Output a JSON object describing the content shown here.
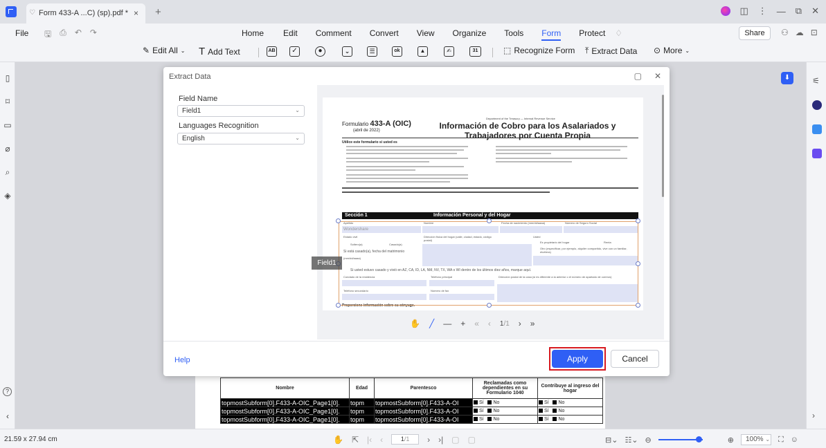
{
  "titlebar": {
    "tab_title": "Form 433-A ...C) (sp).pdf *",
    "tab_close": "×",
    "tab_add": "+",
    "controls": [
      "⋮",
      "—",
      "⧉",
      "✕"
    ]
  },
  "menubar": {
    "file": "File",
    "items": [
      "Home",
      "Edit",
      "Comment",
      "Convert",
      "View",
      "Organize",
      "Tools",
      "Form",
      "Protect"
    ],
    "active": "Form",
    "share": "Share"
  },
  "toolbar": {
    "edit_all": "Edit All",
    "add_text": "Add Text",
    "recognize_form": "Recognize Form",
    "extract_data": "Extract Data",
    "more": "More"
  },
  "dialog": {
    "title": "Extract Data",
    "field_name_label": "Field Name",
    "field_name_value": "Field1",
    "lang_label": "Languages Recognition",
    "lang_value": "English",
    "field_tag": "Field1",
    "help": "Help",
    "apply": "Apply",
    "cancel": "Cancel",
    "preview_page": "1",
    "preview_total": "/1"
  },
  "document": {
    "form_label": "Formulario",
    "form_number": "433-A (OIC)",
    "form_date": "(abril de 2022)",
    "dept": "Department of the Treasury — Internal Revenue Service",
    "title": "Información de Cobro para los Asalariados y Trabajadores por Cuenta Propia",
    "use_heading": "Utilice este formulario si usted es",
    "note": "Nota: Incluya archivos adjuntos si se necesita espacio adicional para responder de manera completa a cualquier pregunta. Este formulario solo se debe utilizar con el Formulario 656 (sp), Ofrecimiento de Transacción.",
    "section_num": "Sección 1",
    "section_title": "Información Personal y del Hogar",
    "apellido": "Apellido",
    "apellido_value": "Wondershare",
    "nombre": "Nombre",
    "fecha": "Fecha de nacimiento (mm/dd/aaaa)",
    "ssn": "Número de Seguro Social",
    "estado_civil": "Estado civil",
    "soltero": "Soltero(a)",
    "casado": "Casado(a)",
    "si_casado": "Si está casado(a), fecha del matrimonio",
    "mmdd": "(mm/dd/aaaa)",
    "direccion": "Dirección física del hogar (calle, ciudad, estado, código postal)",
    "usted": "Usted",
    "propietario": "Es propietario del hogar",
    "renta": "Renta",
    "otro": "Otro (especificar, por ejemplo, alquiler compartido, vive con un familiar, etcétera)",
    "casado_estados": "Si usted estuvo casado y vivió en AZ, CA, ID, LA, NM, NV, TX, WA o WI dentro de los últimos diez años, marque aquí.",
    "condado": "Condado de la residencia",
    "tel_principal": "Teléfono principal",
    "dir_postal": "Dirección postal de la casa (si es diferente a la anterior o el número de apartado de correos)",
    "tel_secundario": "Teléfono secundario",
    "fax": "Número de fax",
    "conyuge": "Proporcione información sobre su cónyuge."
  },
  "bg_table": {
    "headers": [
      "Nombre",
      "Edad",
      "Parentesco",
      "Reclamadas como dependientes en su Formulario 1040",
      "Contribuye al ingreso del hogar"
    ],
    "rows": [
      {
        "name": "topmostSubform[0].F433-A-OIC_Page1[0].",
        "edad": "topm",
        "parentesco": "topmostSubform[0].F433-A-OI",
        "si1": "Sí",
        "no1": "No",
        "si2": "Sí",
        "no2": "No"
      },
      {
        "name": "topmostSubform[0].F433-A-OIC_Page1[0].",
        "edad": "topm",
        "parentesco": "topmostSubform[0].F433-A-OI",
        "si1": "Sí",
        "no1": "No",
        "si2": "Sí",
        "no2": "No"
      },
      {
        "name": "topmostSubform[0].F433-A-OIC_Page1[0].",
        "edad": "topm",
        "parentesco": "topmostSubform[0].F433-A-OI",
        "si1": "Sí",
        "no1": "No",
        "si2": "Sí",
        "no2": "No"
      }
    ]
  },
  "statusbar": {
    "page_size": "21.59 x 27.94 cm",
    "page_value": "1",
    "page_total": "/1",
    "zoom": "100%"
  },
  "colors": {
    "accent": "#2f5ff5",
    "highlight_outline": "#d7191f"
  }
}
